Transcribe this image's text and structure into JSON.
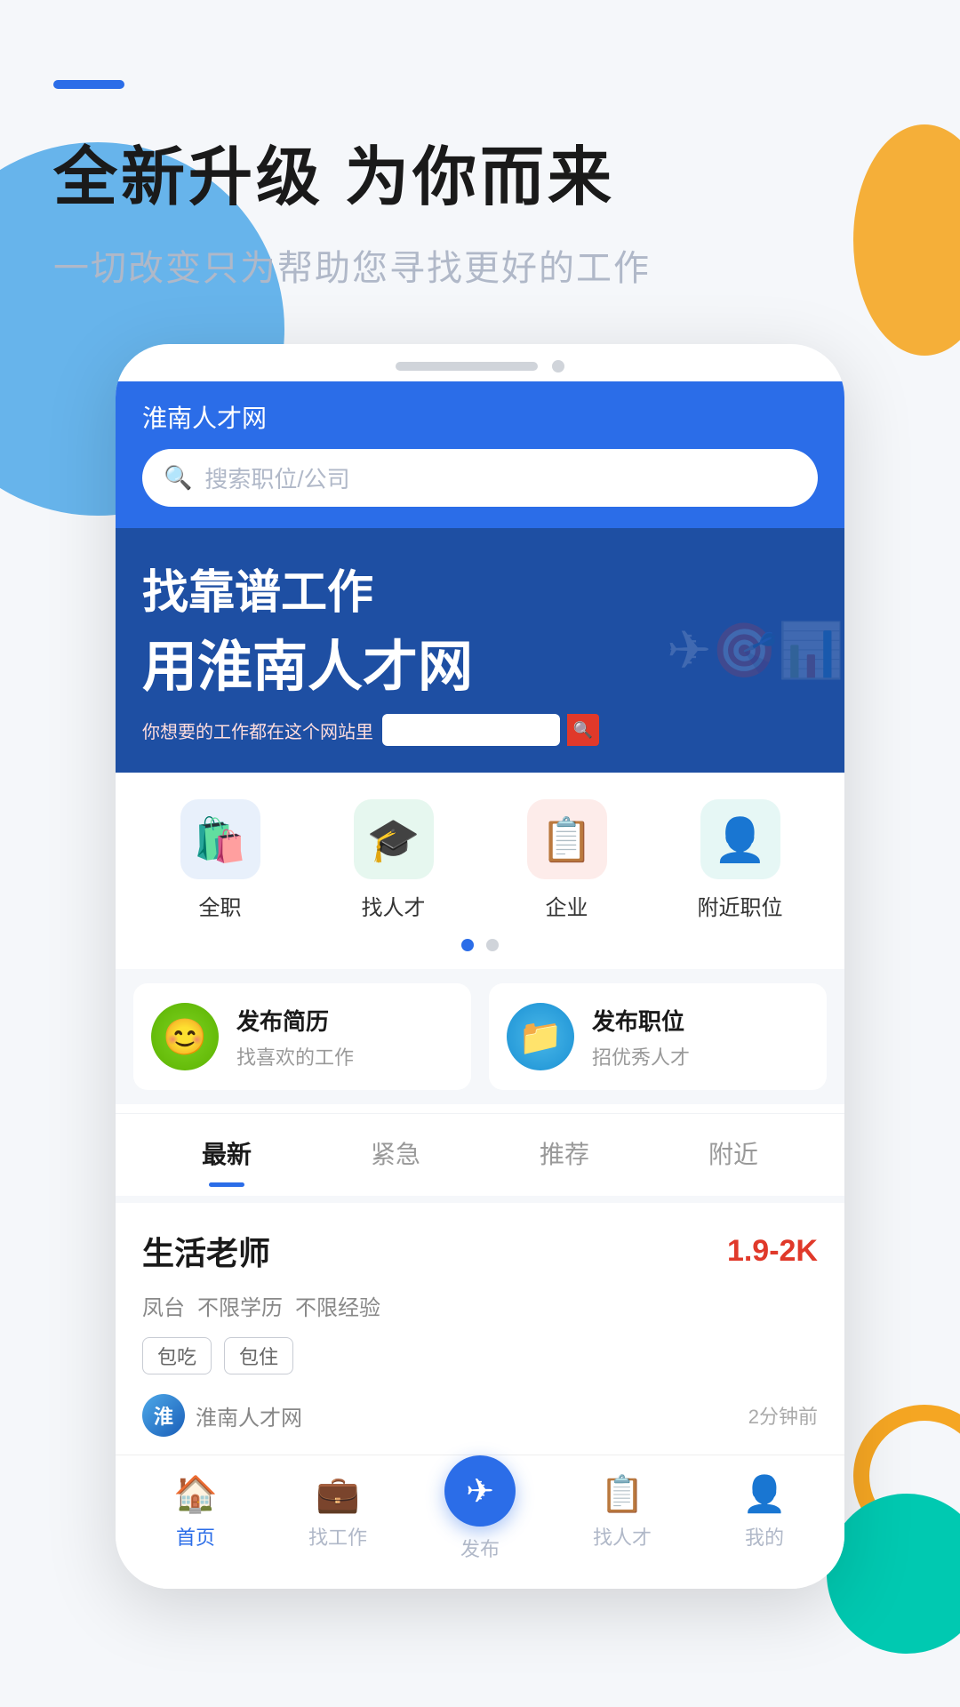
{
  "header": {
    "dash": "",
    "title": "全新升级 为你而来",
    "subtitle": "一切改变只为帮助您寻找更好的工作"
  },
  "phone": {
    "notch_bar": "",
    "notch_dot": ""
  },
  "topbar": {
    "title": "淮南人才网",
    "search_placeholder": "搜索职位/公司"
  },
  "banner": {
    "line1": "找靠谱工作",
    "line2": "用淮南人才网",
    "label": "你想要的工作都在这个网站里"
  },
  "categories": [
    {
      "label": "全职",
      "emoji": "🛍️",
      "color_class": "cat-blue"
    },
    {
      "label": "找人才",
      "emoji": "🎓",
      "color_class": "cat-green"
    },
    {
      "label": "企业",
      "emoji": "📋",
      "color_class": "cat-red"
    },
    {
      "label": "附近职位",
      "emoji": "👤",
      "color_class": "cat-teal"
    }
  ],
  "action_cards": [
    {
      "title": "发布简历",
      "subtitle": "找喜欢的工作",
      "icon_class": "icon-green",
      "emoji": "😊"
    },
    {
      "title": "发布职位",
      "subtitle": "招优秀人才",
      "icon_class": "icon-blue",
      "emoji": "📁"
    }
  ],
  "tabs": [
    {
      "label": "最新",
      "active": true
    },
    {
      "label": "紧急",
      "active": false
    },
    {
      "label": "推荐",
      "active": false
    },
    {
      "label": "附近",
      "active": false
    }
  ],
  "job": {
    "title": "生活老师",
    "salary": "1.9-2K",
    "tags": [
      "凤台",
      "不限学历",
      "不限经验"
    ],
    "badges": [
      "包吃",
      "包住"
    ],
    "company": "淮南人才网",
    "time": "2分钟前"
  },
  "bottom_nav": [
    {
      "label": "首页",
      "emoji": "🏠",
      "active": true
    },
    {
      "label": "找工作",
      "emoji": "💼",
      "active": false
    },
    {
      "label": "发布",
      "emoji": "✈",
      "active": false,
      "center": true
    },
    {
      "label": "找人才",
      "emoji": "📋",
      "active": false
    },
    {
      "label": "我的",
      "emoji": "👤",
      "active": false
    }
  ]
}
